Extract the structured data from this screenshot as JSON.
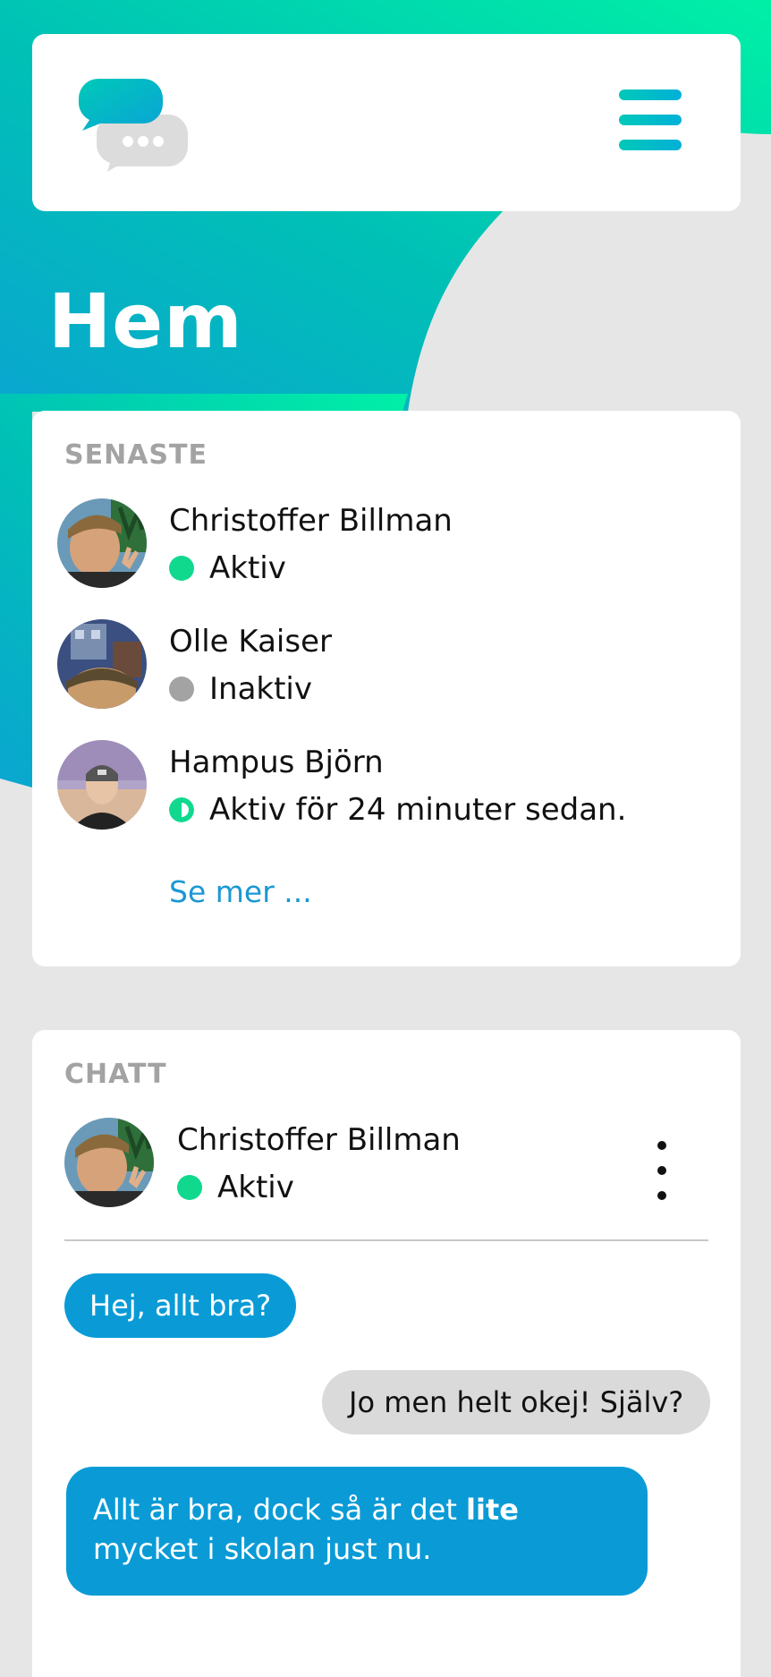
{
  "header": {
    "logo": "chat-bubbles-logo",
    "menu_icon": "hamburger-menu-icon"
  },
  "page": {
    "title": "Hem"
  },
  "colors": {
    "accent_teal": "#00c9b8",
    "accent_blue": "#0a9bd6",
    "status_active": "#10d98e",
    "status_inactive": "#a3a3a3",
    "link": "#1a98d4"
  },
  "recent": {
    "label": "SENASTE",
    "contacts": [
      {
        "name": "Christoffer Billman",
        "status": "Aktiv",
        "status_type": "active"
      },
      {
        "name": "Olle Kaiser",
        "status": "Inaktiv",
        "status_type": "inactive"
      },
      {
        "name": "Hampus Björn",
        "status": "Aktiv för 24 minuter sedan.",
        "status_type": "recent"
      }
    ],
    "see_more": "Se mer ..."
  },
  "chat": {
    "label": "CHATT",
    "contact": {
      "name": "Christoffer Billman",
      "status": "Aktiv"
    },
    "more_icon": "vertical-dots-icon",
    "messages": [
      {
        "from": "them",
        "text": "Hej, allt bra?"
      },
      {
        "from": "me",
        "text": "Jo men helt okej! Själv?"
      },
      {
        "from": "them",
        "text_before": "Allt är bra, dock så är det ",
        "text_bold": "lite",
        "text_after": " mycket i skolan just nu."
      }
    ]
  }
}
